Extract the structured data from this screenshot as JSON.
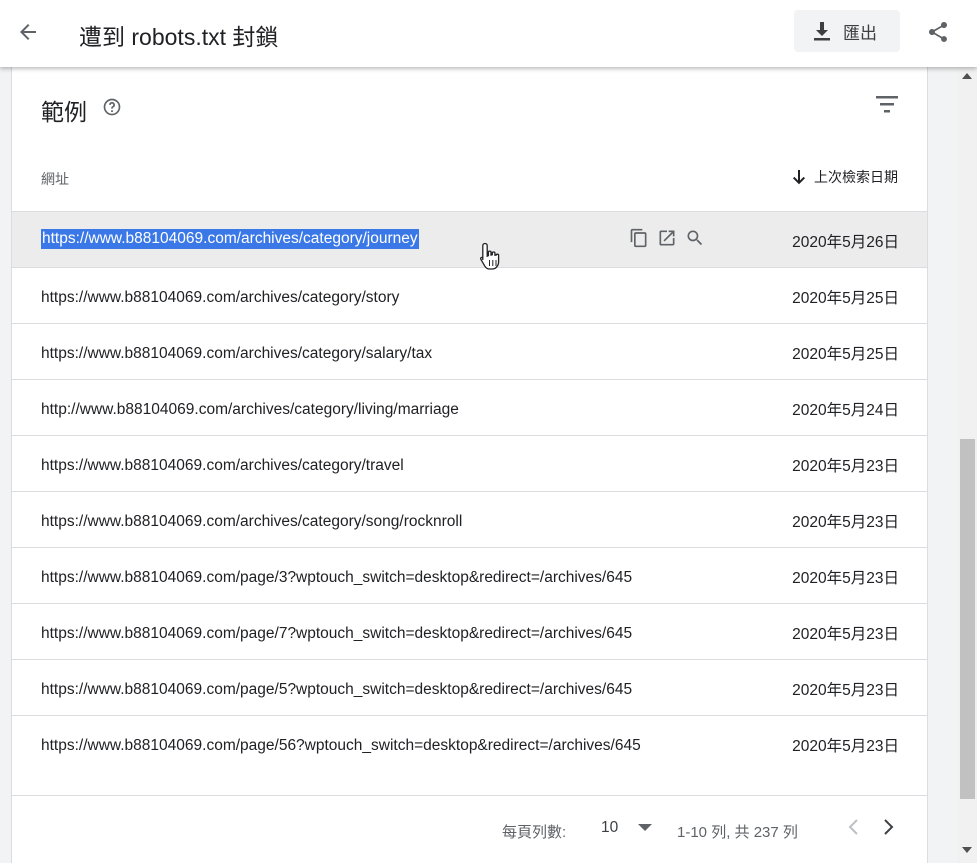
{
  "header": {
    "title": "遭到 robots.txt 封鎖",
    "export_label": "匯出"
  },
  "card": {
    "title": "範例",
    "col_url": "網址",
    "col_date": "上次檢索日期"
  },
  "rows": [
    {
      "url": "https://www.b88104069.com/archives/category/journey",
      "date": "2020年5月26日"
    },
    {
      "url": "https://www.b88104069.com/archives/category/story",
      "date": "2020年5月25日"
    },
    {
      "url": "https://www.b88104069.com/archives/category/salary/tax",
      "date": "2020年5月25日"
    },
    {
      "url": "http://www.b88104069.com/archives/category/living/marriage",
      "date": "2020年5月24日"
    },
    {
      "url": "https://www.b88104069.com/archives/category/travel",
      "date": "2020年5月23日"
    },
    {
      "url": "https://www.b88104069.com/archives/category/song/rocknroll",
      "date": "2020年5月23日"
    },
    {
      "url": "https://www.b88104069.com/page/3?wptouch_switch=desktop&redirect=/archives/645",
      "date": "2020年5月23日"
    },
    {
      "url": "https://www.b88104069.com/page/7?wptouch_switch=desktop&redirect=/archives/645",
      "date": "2020年5月23日"
    },
    {
      "url": "https://www.b88104069.com/page/5?wptouch_switch=desktop&redirect=/archives/645",
      "date": "2020年5月23日"
    },
    {
      "url": "https://www.b88104069.com/page/56?wptouch_switch=desktop&redirect=/archives/645",
      "date": "2020年5月23日"
    }
  ],
  "pagination": {
    "rows_per_page_label": "每頁列數:",
    "rows_per_page_value": "10",
    "range_text": "1-10 列, 共 237 列"
  },
  "icons": {
    "back": "arrow-left-icon",
    "export": "download-icon",
    "share": "share-icon",
    "help": "help-circle-icon",
    "filter": "filter-icon",
    "sort": "arrow-down-icon",
    "copy": "copy-icon",
    "open": "open-in-new-icon",
    "inspect": "search-icon"
  },
  "colors": {
    "selection": "#3b78e7",
    "hover_row": "#ececec"
  }
}
